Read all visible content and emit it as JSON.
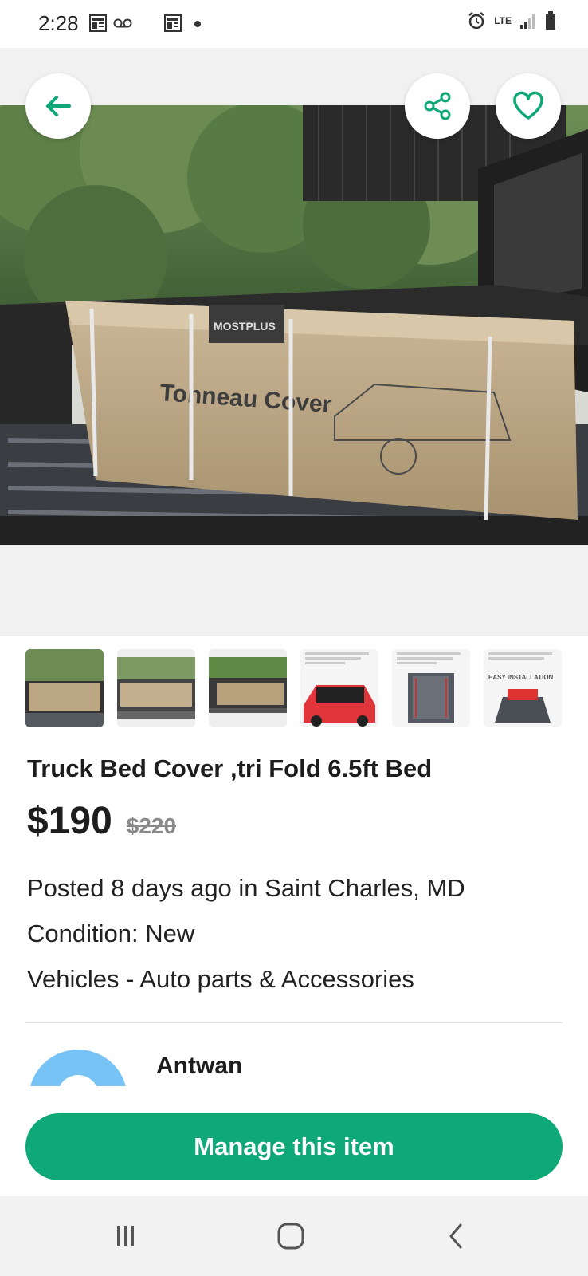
{
  "status_bar": {
    "time": "2:28",
    "network": "LTE",
    "icons": [
      "news-icon",
      "voicemail-icon",
      "news-icon",
      "dot-icon",
      "alarm-icon",
      "signal-icon",
      "battery-icon"
    ]
  },
  "hero": {
    "back_icon": "arrow-left-icon",
    "share_icon": "share-icon",
    "favorite_icon": "heart-icon",
    "accent_color": "#0fa877"
  },
  "thumbnails": [
    {
      "name": "photo-1"
    },
    {
      "name": "photo-2"
    },
    {
      "name": "photo-3"
    },
    {
      "name": "product-image-1"
    },
    {
      "name": "product-image-2"
    },
    {
      "name": "product-image-3",
      "caption": "EASY INSTALLATION"
    }
  ],
  "listing": {
    "title": "Truck  Bed Cover ,tri Fold 6.5ft Bed",
    "price": "$190",
    "original_price": "$220",
    "posted": "Posted 8 days ago in Saint Charles, MD",
    "condition": "Condition: New",
    "category": "Vehicles - Auto parts & Accessories"
  },
  "seller": {
    "name": "Antwan"
  },
  "actions": {
    "manage_label": "Manage this item"
  },
  "nav": {
    "recents_icon": "recents-icon",
    "home_icon": "home-icon",
    "back_icon": "back-icon"
  }
}
